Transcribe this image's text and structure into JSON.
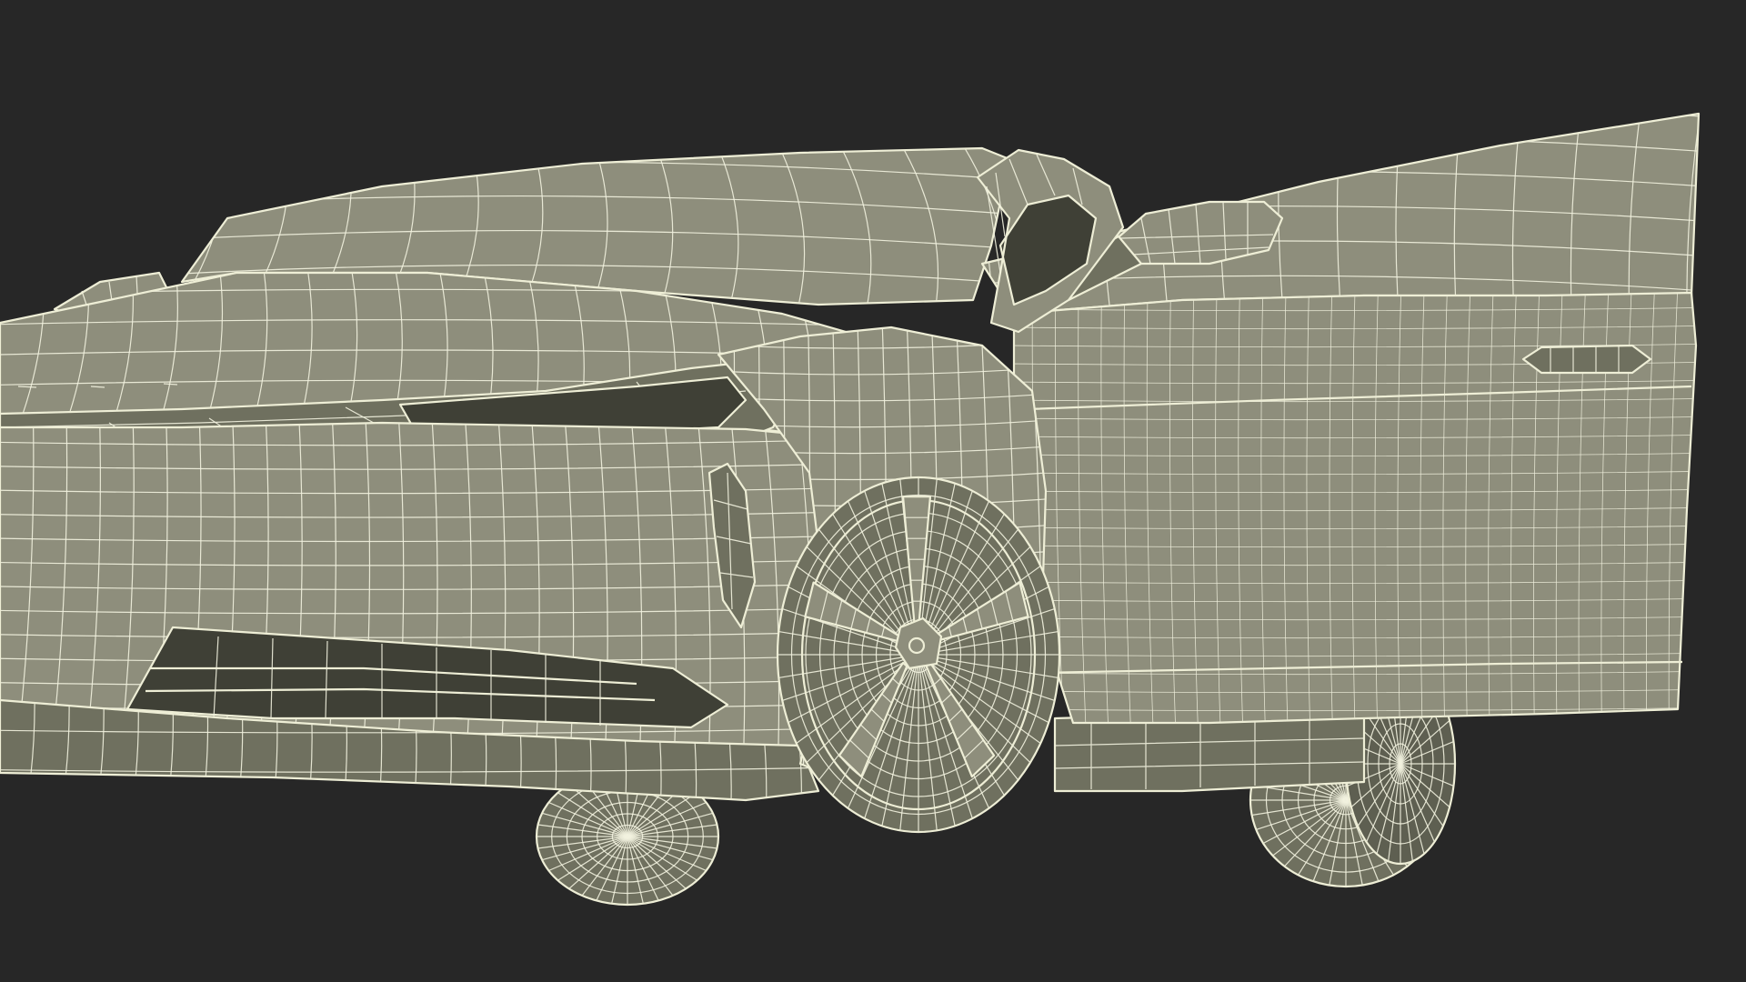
{
  "scene": {
    "subject": "car-wireframe-render",
    "background_color": "#272727",
    "surface_color": "#8e8e7c",
    "wire_color": "#f2f2df"
  }
}
